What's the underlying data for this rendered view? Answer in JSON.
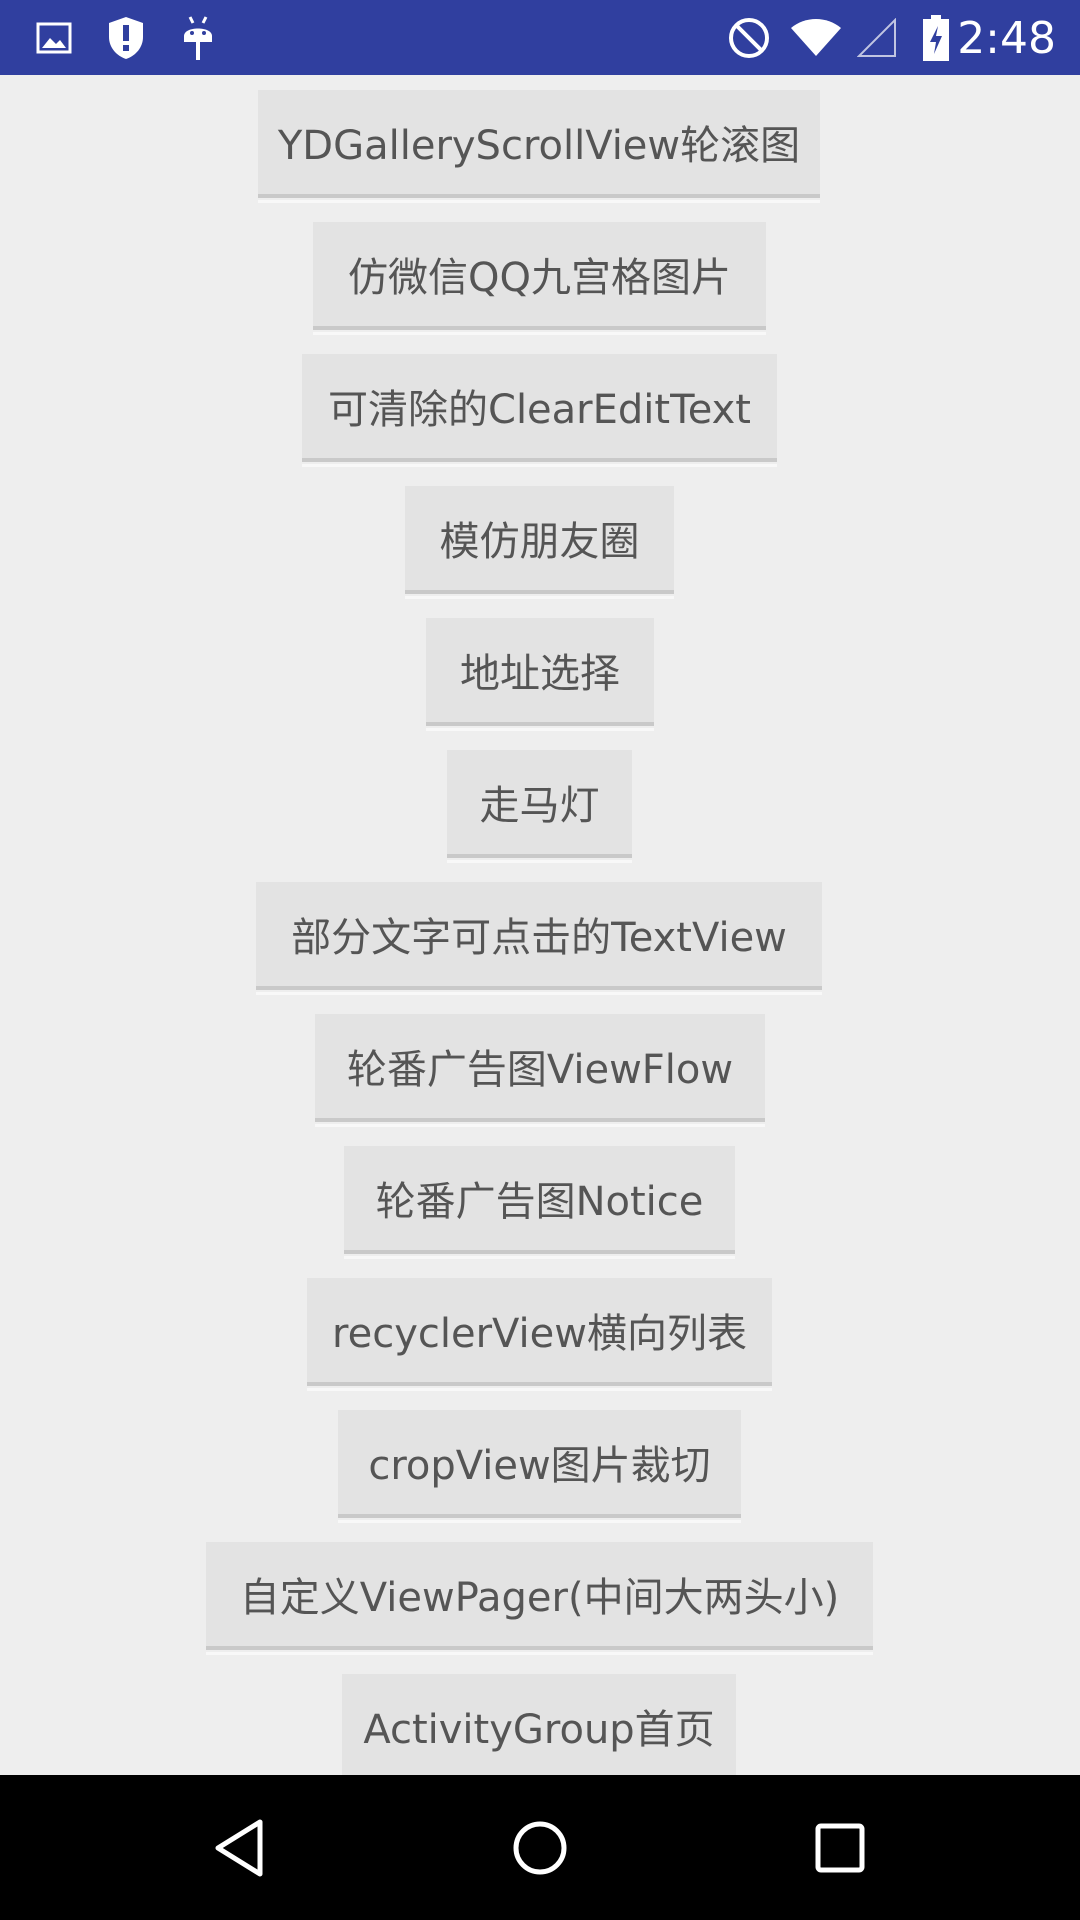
{
  "status_bar": {
    "time": "2:48",
    "left_icons": [
      "image-icon",
      "shield-alert-icon",
      "android-debug-icon"
    ],
    "right_icons": [
      "do-not-disturb-icon",
      "wifi-icon",
      "cellular-signal-icon",
      "battery-charging-icon"
    ],
    "background_color": "#303f9f"
  },
  "buttons": [
    {
      "label": "YDGalleryScrollView轮滚图"
    },
    {
      "label": "仿微信QQ九宫格图片"
    },
    {
      "label": "可清除的ClearEditText"
    },
    {
      "label": "模仿朋友圈"
    },
    {
      "label": "地址选择"
    },
    {
      "label": "走马灯"
    },
    {
      "label": "部分文字可点击的TextView"
    },
    {
      "label": "轮番广告图ViewFlow"
    },
    {
      "label": "轮番广告图Notice"
    },
    {
      "label": "recyclerView横向列表"
    },
    {
      "label": "cropView图片裁切"
    },
    {
      "label": "自定义ViewPager(中间大两头小)"
    },
    {
      "label": "ActivityGroup首页"
    }
  ],
  "nav_bar": {
    "icons": [
      "back-icon",
      "home-icon",
      "recents-icon"
    ]
  }
}
